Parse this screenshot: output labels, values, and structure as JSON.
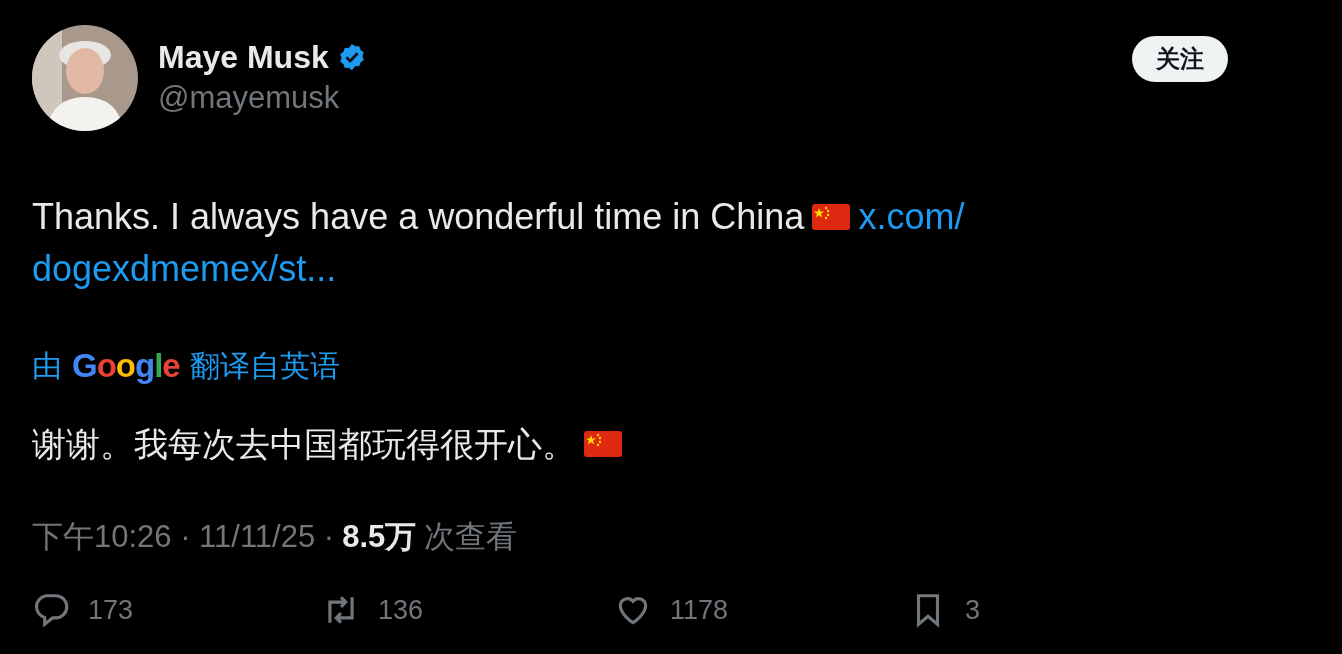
{
  "author": {
    "name": "Maye Musk",
    "verified": true,
    "handle": "@mayemusk"
  },
  "follow_button": {
    "label": "关注"
  },
  "tweet": {
    "text": "Thanks. I always have a wonderful time in China",
    "link_lines": [
      "x.com/",
      "dogexdmemex/st..."
    ]
  },
  "translation": {
    "prefix": "由",
    "provider": "Google",
    "suffix": "翻译自英语",
    "text": "谢谢。我每次去中国都玩得很开心。"
  },
  "meta": [
    {
      "kind": "plain",
      "text": "下午10:26 · 11/11/25 ·"
    },
    {
      "kind": "strong",
      "text": "8.5万"
    },
    {
      "kind": "plain",
      "text": "次查看"
    }
  ],
  "actions": [
    {
      "kind": "reply",
      "count": "173"
    },
    {
      "kind": "retweet",
      "count": "136"
    },
    {
      "kind": "like",
      "count": "1178"
    },
    {
      "kind": "bookmark",
      "count": "3"
    }
  ]
}
